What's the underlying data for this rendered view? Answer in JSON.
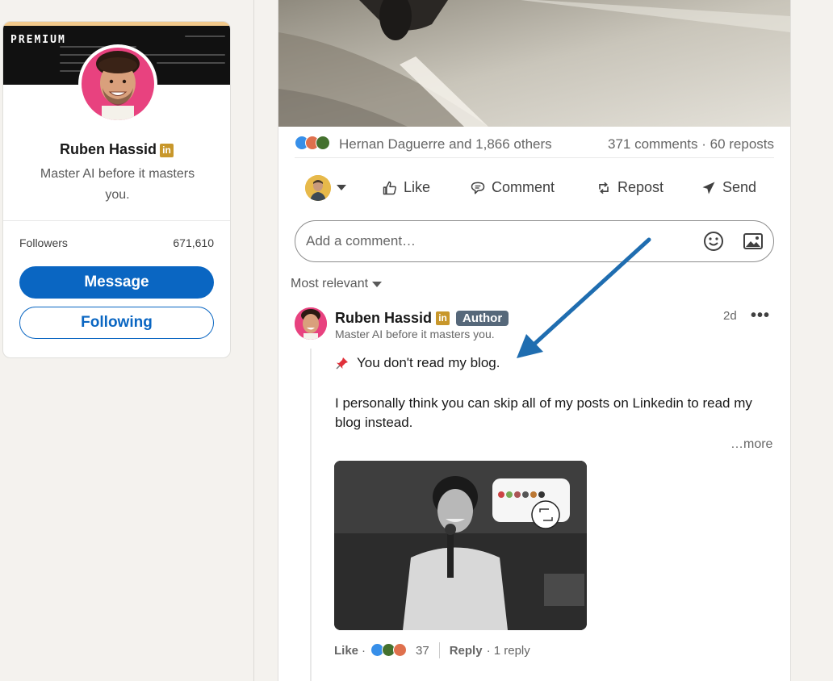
{
  "profile": {
    "banner_label": "PREMIUM",
    "name": "Ruben Hassid",
    "linkedin_badge": "in",
    "headline": "Master AI before it masters you.",
    "followers_label": "Followers",
    "followers_count": "671,610",
    "message_label": "Message",
    "following_label": "Following"
  },
  "post": {
    "reactors_text": "Hernan Daguerre and 1,866 others",
    "comments_reposts": "371 comments · 60 reposts",
    "actions": {
      "like": "Like",
      "comment": "Comment",
      "repost": "Repost",
      "send": "Send"
    },
    "comment_placeholder": "Add a comment…",
    "sort_label": "Most relevant"
  },
  "comment": {
    "author": "Ruben Hassid",
    "linkedin_badge": "in",
    "author_badge": "Author",
    "headline": "Master AI before it masters you.",
    "time": "2d",
    "more_button": "•••",
    "pinned_text": "You don't read my blog.",
    "body": "I personally think you can skip all of my posts on Linkedin to read my blog instead.",
    "see_more": "…more",
    "like_label": "Like",
    "dot": "·",
    "reaction_count": "37",
    "reply_label": "Reply",
    "reply_count": "· 1 reply"
  },
  "colors": {
    "brand_blue": "#0a66c2",
    "author_badge_bg": "#56687a",
    "linkedin_gold": "#c8972b",
    "annotation_arrow": "#1f6db0"
  },
  "icons": [
    "linkedin-badge-icon",
    "like-icon",
    "comment-icon",
    "repost-icon",
    "send-icon",
    "emoji-icon",
    "photo-icon",
    "pin-icon",
    "more-icon"
  ]
}
